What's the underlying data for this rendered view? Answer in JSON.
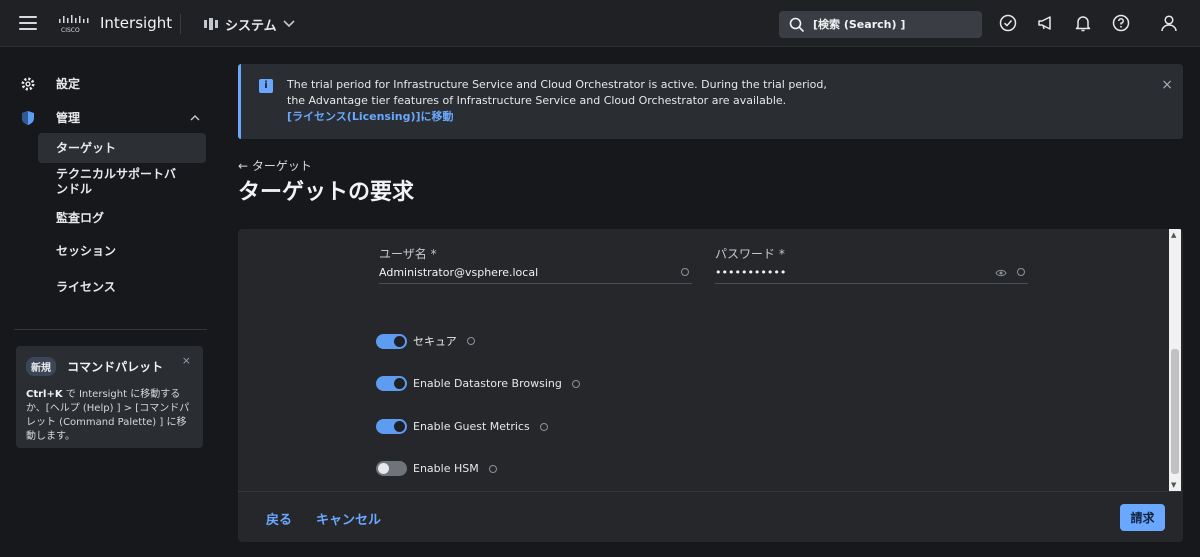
{
  "topbar": {
    "brand": "Intersight",
    "system_label": "システム",
    "search_placeholder": "[検索 (Search) ]"
  },
  "sidebar": {
    "settings": "設定",
    "admin": "管理",
    "items": [
      {
        "label": "ターゲット"
      },
      {
        "label": "テクニカルサポートバンドル"
      },
      {
        "label": "監査ログ"
      },
      {
        "label": "セッション"
      },
      {
        "label": "ライセンス"
      }
    ],
    "palette": {
      "badge": "新規",
      "title": "コマンドパレット",
      "close": "×",
      "shortcut": "Ctrl+K",
      "body": " で Intersight に移動するか、[ヘルプ (Help) ] > [コマンドパレット (Command Palette) ] に移動します。"
    }
  },
  "banner": {
    "text": "The trial period for Infrastructure Service and Cloud Orchestrator is active. During the trial period, the Advantage tier features of Infrastructure Service and Cloud Orchestrator are available.",
    "link": "[ライセンス(Licensing)]に移動",
    "close": "×"
  },
  "breadcrumb": "← ターゲット",
  "page_title": "ターゲットの要求",
  "form": {
    "username_label": "ユーザ名 *",
    "username_value": "Administrator@vsphere.local",
    "password_label": "パスワード *",
    "password_value": "•••••••••••",
    "toggles": [
      {
        "label": "セキュア",
        "on": true
      },
      {
        "label": "Enable Datastore Browsing",
        "on": true
      },
      {
        "label": "Enable Guest Metrics",
        "on": true
      },
      {
        "label": "Enable HSM",
        "on": false
      }
    ]
  },
  "footer": {
    "back": "戻る",
    "cancel": "キャンセル",
    "submit": "請求"
  },
  "colors": {
    "accent": "#6aa8ff",
    "toggle_on": "#5d9cf0"
  }
}
